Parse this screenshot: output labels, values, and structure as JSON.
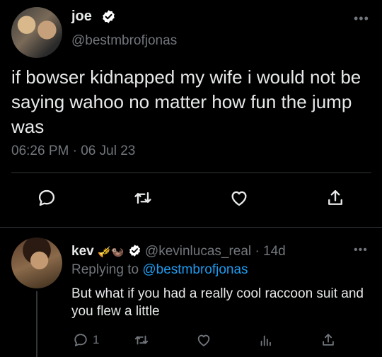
{
  "tweet": {
    "author_name": "joe",
    "author_handle": "@bestmbrofjonas",
    "text": "if bowser kidnapped my wife i would not be saying wahoo no matter how fun the jump was",
    "timestamp": "06:26 PM · 06 Jul 23",
    "more": "•••"
  },
  "reply": {
    "author_name": "kev",
    "emoji": "🎺🦦",
    "author_handle": "@kevinlucas_real",
    "age": "· 14d",
    "replying_prefix": "Replying to",
    "replying_handle": "@bestmbrofjonas",
    "text": "But what if you had a really cool raccoon suit and you flew a little",
    "reply_count": "1",
    "more": "•••"
  },
  "colors": {
    "background": "#000000",
    "text": "#e7e9ea",
    "muted": "#71767b",
    "link": "#1d9bf0",
    "verified": "#ffffff"
  },
  "icons": [
    "reply-icon",
    "retweet-icon",
    "like-icon",
    "share-icon",
    "views-icon",
    "verified-icon",
    "more-icon"
  ]
}
